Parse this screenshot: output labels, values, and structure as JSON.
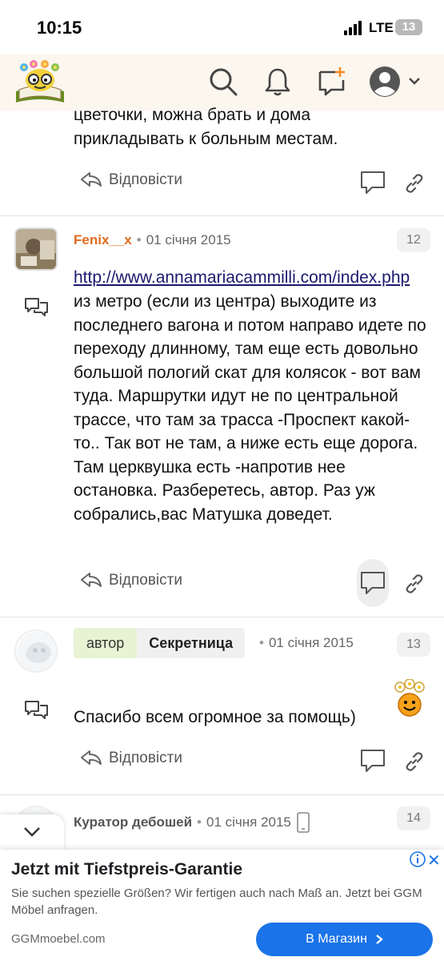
{
  "status_bar": {
    "time": "10:15",
    "network": "LTE",
    "battery": "13"
  },
  "header": {
    "logo_icon": "flower-book-logo-icon",
    "icons": [
      "search-icon",
      "bell-icon",
      "new-post-icon",
      "avatar-icon",
      "chevron-down-icon"
    ]
  },
  "comments": [
    {
      "text": "цветочки, можна брать и дома прикладывать к больным местам.",
      "reply_label": "Відповісти"
    },
    {
      "author": "Fenix__x",
      "date": "01 січня 2015",
      "number": "12",
      "link": "http://www.annamariacammilli.com/index.php",
      "text": "из метро (если из центра) выходите из последнего вагона и потом направо идете по переходу длинному, там еще есть довольно большой пологий скат для колясок - вот вам туда. Маршрутки идут не по центральной трассе, что там за трасса -Проспект какой-то.. Так вот не там, а ниже есть еще дорога. Там церквушка есть -напротив нее остановка. Разберетесь, автор. Раз уж собрались,вас Матушка доведет.",
      "reply_label": "Відповісти"
    },
    {
      "badge_label": "автор",
      "author": "Секретница",
      "date": "01 січня 2015",
      "number": "13",
      "text": "Спасибо всем огромное за помощь)",
      "reply_label": "Відповісти"
    },
    {
      "author": "Куратор дебошей",
      "date": "01 січня 2015",
      "number": "14"
    }
  ],
  "ad": {
    "title": "Jetzt mit Tiefstpreis-Garantie",
    "description": "Sie suchen spezielle Größen? Wir fertigen auch nach Maß an. Jetzt bei GGM Möbel anfragen.",
    "domain": "GGMmoebel.com",
    "cta_label": "В Магазин",
    "close_label": "✕"
  },
  "colors": {
    "author_orange": "#e06a1e",
    "badge_green": "#e7f3d3",
    "cta_blue": "#1a73e8"
  }
}
